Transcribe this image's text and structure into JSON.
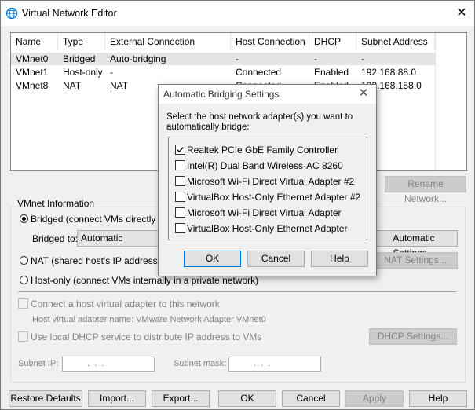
{
  "window": {
    "title": "Virtual Network Editor",
    "close_symbol": "✕"
  },
  "network_table": {
    "columns": [
      "Name",
      "Type",
      "External Connection",
      "Host Connection",
      "DHCP",
      "Subnet Address"
    ],
    "rows": [
      [
        "VMnet0",
        "Bridged",
        "Auto-bridging",
        "-",
        "-",
        "-"
      ],
      [
        "VMnet1",
        "Host-only",
        "-",
        "Connected",
        "Enabled",
        "192.168.88.0"
      ],
      [
        "VMnet8",
        "NAT",
        "NAT",
        "Connected",
        "Enabled",
        "192.168.158.0"
      ]
    ]
  },
  "rename_network_button": "Rename Network...",
  "vmnet_info": {
    "group_label": "VMnet Information",
    "bridged_label": "Bridged (connect VMs directly to th",
    "bridged_to_label": "Bridged to:",
    "bridged_to_value": "Automatic",
    "automatic_settings_button": "Automatic Settings...",
    "nat_label": "NAT (shared host's IP address wit",
    "nat_settings_button": "NAT Settings...",
    "host_only_label": "Host-only (connect VMs internally in a private network)",
    "connect_adapter_label": "Connect a host virtual adapter to this network",
    "adapter_name_label": "Host virtual adapter name: VMware Network Adapter VMnet0",
    "dhcp_label": "Use local DHCP service to distribute IP address to VMs",
    "dhcp_settings_button": "DHCP Settings...",
    "subnet_ip_label": "Subnet IP:",
    "subnet_ip_value": " .  .  . ",
    "subnet_mask_label": "Subnet mask:",
    "subnet_mask_value": " .  .  . "
  },
  "footer": {
    "restore_defaults": "Restore Defaults",
    "import": "Import...",
    "export": "Export...",
    "ok": "OK",
    "cancel": "Cancel",
    "apply": "Apply",
    "help": "Help"
  },
  "dialog": {
    "title": "Automatic Bridging Settings",
    "close_symbol": "✕",
    "instruction_line1": "Select the host network adapter(s) you want to",
    "instruction_line2": "automatically bridge:",
    "adapters": [
      {
        "label": "Realtek PCIe GbE Family Controller",
        "checked": true
      },
      {
        "label": "Intel(R) Dual Band Wireless-AC 8260",
        "checked": false
      },
      {
        "label": "Microsoft Wi-Fi Direct Virtual Adapter #2",
        "checked": false
      },
      {
        "label": "VirtualBox Host-Only Ethernet Adapter #2",
        "checked": false
      },
      {
        "label": "Microsoft Wi-Fi Direct Virtual Adapter",
        "checked": false
      },
      {
        "label": "VirtualBox Host-Only Ethernet Adapter",
        "checked": false
      }
    ],
    "ok": "OK",
    "cancel": "Cancel",
    "help": "Help"
  },
  "colors": {
    "app_icon": "#0078d7",
    "default_button_border": "#0078d7",
    "selected_row": "#e5e5e5"
  }
}
